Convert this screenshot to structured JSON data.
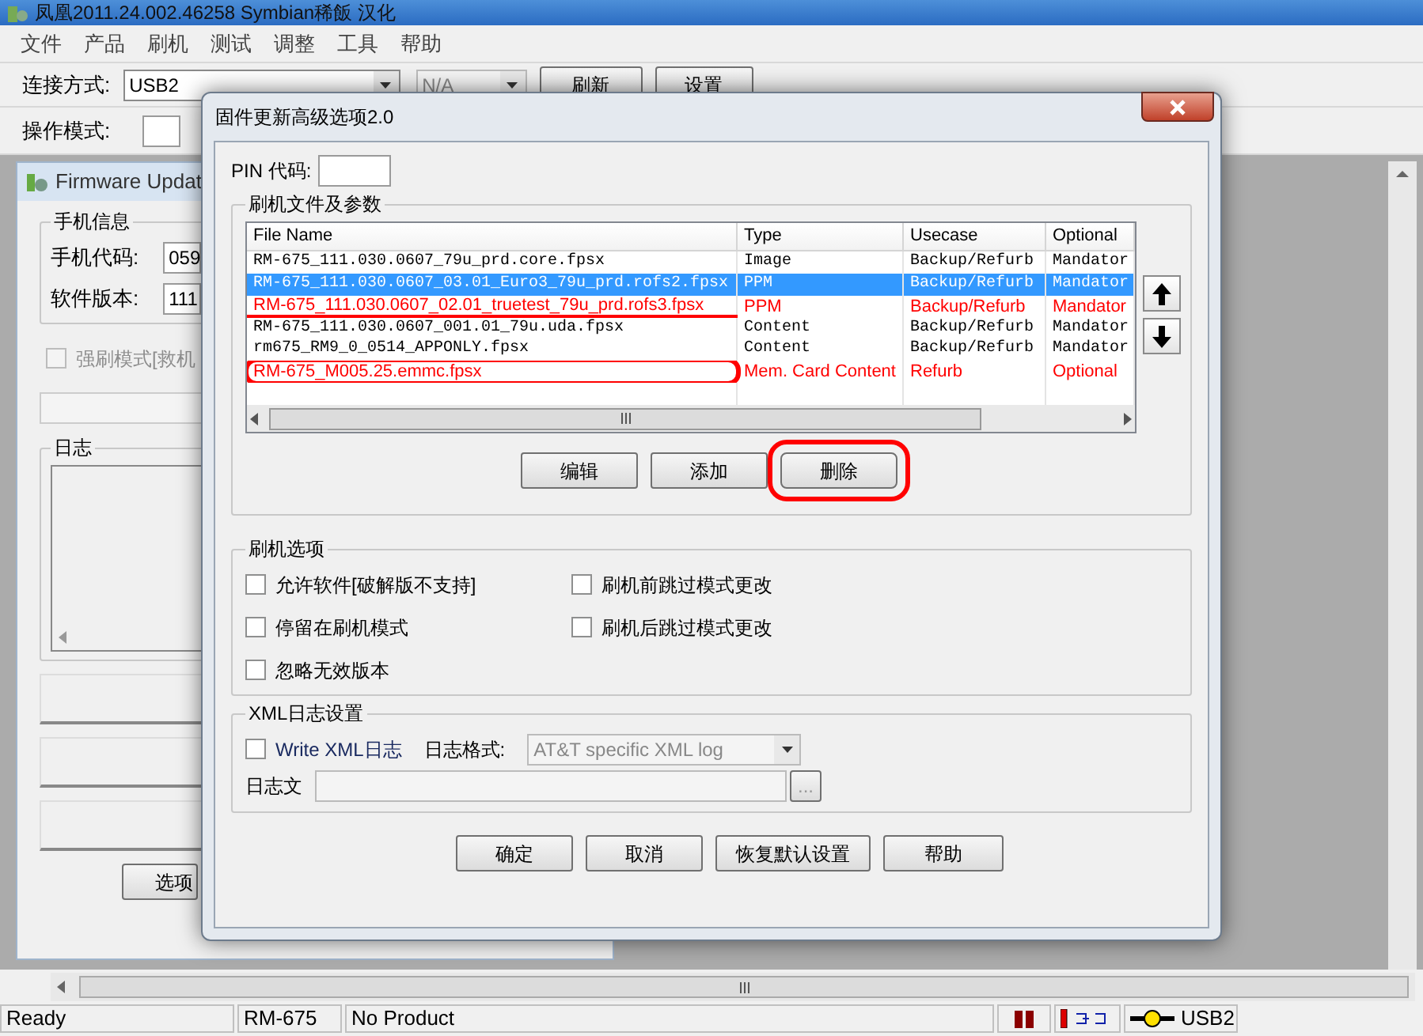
{
  "app": {
    "title": "凤凰2011.24.002.46258  Symbian稀飯 汉化",
    "menu": [
      "文件",
      "产品",
      "刷机",
      "测试",
      "调整",
      "工具",
      "帮助"
    ],
    "toolbar": {
      "connection_label": "连接方式:",
      "connection_value": "USB2",
      "mode_value": "N/A",
      "refresh_button": "刷新",
      "settings_button": "设置",
      "operation_label": "操作模式:"
    },
    "firmware_panel": {
      "title": "Firmware Updat",
      "phone_info_group": "手机信息",
      "phone_code_label": "手机代码:",
      "phone_code": "059",
      "sw_version_label": "软件版本:",
      "sw_version": "111",
      "force_mode": {
        "label": "强刷模式[救机",
        "checked": false,
        "disabled": true
      },
      "log_group": "日志",
      "options_button": "选项"
    },
    "status_bar": {
      "state": "Ready",
      "model": "RM-675",
      "product": "No Product",
      "connection": "USB2"
    }
  },
  "dialog": {
    "title": "固件更新高级选项2.0",
    "pin_label": "PIN 代码:",
    "files_group": "刷机文件及参数",
    "columns": [
      "File Name",
      "Type",
      "Usecase",
      "Optional"
    ],
    "rows": [
      {
        "cells": [
          "RM-675_111.030.0607_79u_prd.core.fpsx",
          "Image",
          "Backup/Refurb",
          "Mandator"
        ],
        "selected": false,
        "kind": "plain",
        "color": "#000000"
      },
      {
        "cells": [
          "RM-675_111.030.0607_03.01_Euro3_79u_prd.rofs2.fpsx",
          "PPM",
          "Backup/Refurb",
          "Mandator"
        ],
        "selected": true,
        "kind": "plain"
      },
      {
        "cells": [
          "RM-675_111.030.0607_02.01_truetest_79u_prd.rofs3.fpsx",
          "PPM",
          "Backup/Refurb",
          "Mandator"
        ],
        "selected": false,
        "kind": "marked",
        "color": "#ff0000",
        "underlined": true
      },
      {
        "cells": [
          "RM-675_111.030.0607_001.01_79u.uda.fpsx",
          "Content",
          "Backup/Refurb",
          "Mandator"
        ],
        "selected": false,
        "kind": "plain",
        "color": "#000000"
      },
      {
        "cells": [
          "rm675_RM9_0_0514_APPONLY.fpsx",
          "Content",
          "Backup/Refurb",
          "Mandator"
        ],
        "selected": false,
        "kind": "plain",
        "color": "#000000"
      },
      {
        "cells": [
          "RM-675_M005.25.emmc.fpsx",
          "Mem. Card Content",
          "Refurb",
          "Optional"
        ],
        "selected": false,
        "kind": "marked",
        "color": "#ff0000",
        "circled": true
      }
    ],
    "list_buttons": [
      {
        "label": "编辑",
        "circled": false
      },
      {
        "label": "添加",
        "circled": false
      },
      {
        "label": "删除",
        "circled": true
      }
    ],
    "options_group": "刷机选项",
    "options": [
      {
        "label": "允许软件[破解版不支持]",
        "checked": false
      },
      {
        "label": "刷机前跳过模式更改",
        "checked": false
      },
      {
        "label": "停留在刷机模式",
        "checked": false
      },
      {
        "label": "刷机后跳过模式更改",
        "checked": false
      },
      {
        "label": "忽略无效版本",
        "checked": false
      }
    ],
    "xml_group": "XML日志设置",
    "xml_write": {
      "label": "Write XML日志",
      "checked": false
    },
    "format_label": "日志格式:",
    "format_value": "AT&T specific XML log",
    "file_label": "日志文",
    "browse_button": "...",
    "buttons": [
      "确定",
      "取消",
      "恢复默认设置",
      "帮助"
    ]
  }
}
